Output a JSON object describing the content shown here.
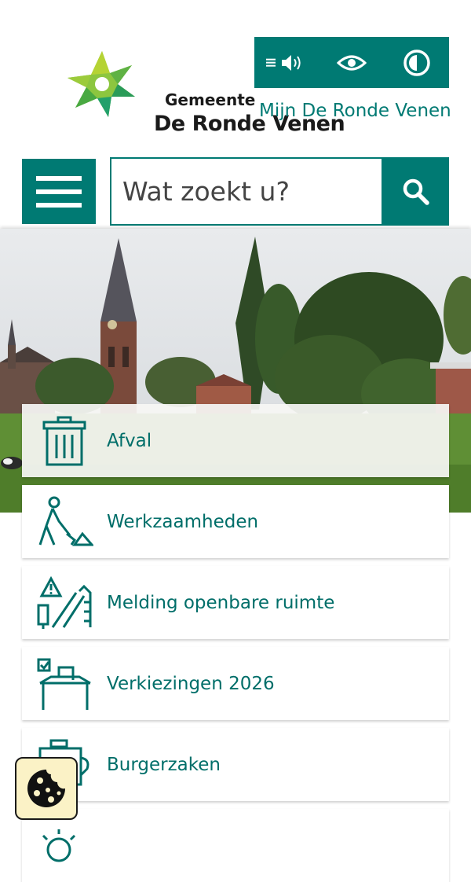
{
  "header": {
    "brand_line1": "Gemeente",
    "brand_line2": "De Ronde Venen",
    "mijn_link": "Mijn De Ronde Venen"
  },
  "a11y_tools": [
    {
      "icon": "read-aloud-icon"
    },
    {
      "icon": "eye-icon"
    },
    {
      "icon": "contrast-icon"
    }
  ],
  "search": {
    "placeholder": "Wat zoekt u?"
  },
  "tiles": [
    {
      "label": "Afval",
      "icon": "trash-bin-icon"
    },
    {
      "label": "Werkzaamheden",
      "icon": "road-worker-icon"
    },
    {
      "label": "Melding openbare ruimte",
      "icon": "warning-street-icon"
    },
    {
      "label": "Verkiezingen 2026",
      "icon": "ballot-box-icon"
    },
    {
      "label": "Burgerzaken",
      "icon": "document-stamp-icon"
    }
  ],
  "colors": {
    "brand": "#007a73",
    "brand_text": "#006e69",
    "cookie_bg": "#fbf2c6"
  },
  "cookie": {
    "icon": "cookie-icon"
  }
}
